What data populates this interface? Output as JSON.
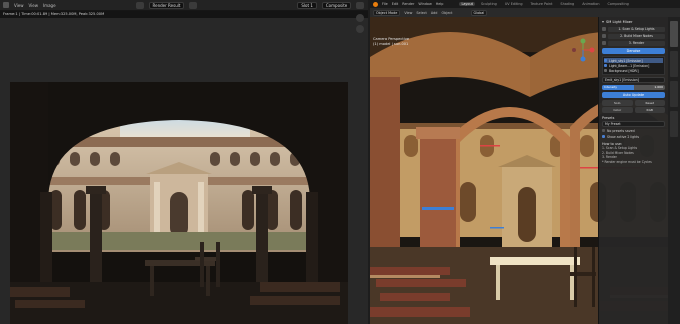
{
  "left": {
    "menus": [
      "View",
      "View",
      "Image"
    ],
    "image_field": "Render Result",
    "slot": "Slot 1",
    "layer": "Composite",
    "stats": "Frame:1 | Time:00:01.89 | Mem:325.00M, Peak:325.00M"
  },
  "right": {
    "menus": [
      "File",
      "Edit",
      "Render",
      "Window",
      "Help"
    ],
    "workspaces": [
      "Layout",
      "Sculpting",
      "UV Editing",
      "Texture Paint",
      "Shading",
      "Animation",
      "Compositing"
    ],
    "active_workspace": "Layout",
    "mode": "Object Mode",
    "view_menus": [
      "View",
      "Select",
      "Add",
      "Object"
    ],
    "shading": "Global",
    "viewport_title": "Camera Perspective",
    "viewport_subtitle": "(1) model | sun.001"
  },
  "npanel": {
    "title": "SM Light Mixer",
    "steps": [
      "1. Scan & Setup Lights",
      "2. Build Mixer Nodes",
      "3. Render"
    ],
    "denoise": "Denoise",
    "lights": [
      "Light_sky1 [Emission]",
      "Light_Beam...1 [Emission]",
      "Background [HDRI]"
    ],
    "selected_name": "Emit_sky1 [Emission]",
    "intensity_label": "Intensity",
    "intensity_value": "1.000",
    "intensity_fraction": 0.5,
    "auto_update": "Auto Update",
    "solo": "Solo",
    "reset": "Reset",
    "color_label": "Color",
    "color_value": "RGB",
    "presets_label": "Presets",
    "preset_value": "My Preset",
    "no_presets": "No presets saved",
    "show_active": "Show active 2 lights",
    "howto_title": "How to use:",
    "howto": [
      "1. Scan & Setup Lights",
      "2. Build Mixer Nodes",
      "3. Render",
      "* Render engine must be Cycles"
    ]
  }
}
